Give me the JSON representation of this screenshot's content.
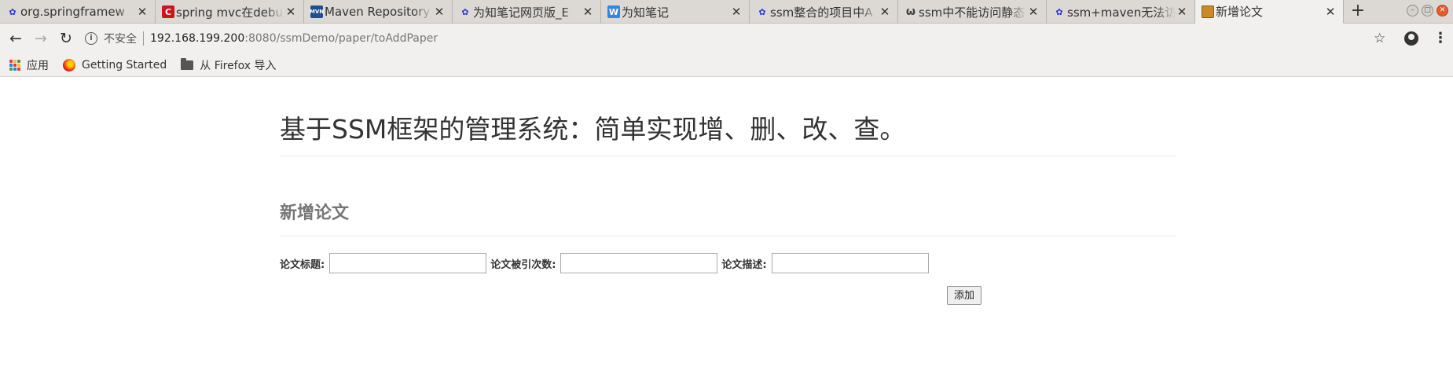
{
  "browser": {
    "tabs": [
      {
        "title": "org.springframew",
        "favicon": "baidu-paw-icon",
        "favicon_color": "#2932e1",
        "active": false
      },
      {
        "title": "spring mvc在debu",
        "favicon": "csdn-icon",
        "favicon_color": "#c9161d",
        "active": false
      },
      {
        "title": "Maven Repository",
        "favicon": "mvn-icon",
        "favicon_color": "#1f4f8f",
        "active": false
      },
      {
        "title": "为知笔记网页版_E",
        "favicon": "baidu-paw-icon",
        "favicon_color": "#2932e1",
        "active": false
      },
      {
        "title": "为知笔记",
        "favicon": "wiz-icon",
        "favicon_color": "#2f87e6",
        "active": false
      },
      {
        "title": "ssm整合的项目中A",
        "favicon": "baidu-paw-icon",
        "favicon_color": "#2932e1",
        "active": false
      },
      {
        "title": "ssm中不能访问静态",
        "favicon": "omega-icon",
        "favicon_color": "#444444",
        "active": false
      },
      {
        "title": "ssm+maven无法访",
        "favicon": "baidu-paw-icon",
        "favicon_color": "#2932e1",
        "active": false
      },
      {
        "title": "新增论文",
        "favicon": "page-icon",
        "favicon_color": "#c98b2a",
        "active": true
      }
    ],
    "new_tab": "+",
    "address": {
      "security_label": "不安全",
      "url_host": "192.168.199.200",
      "url_rest": ":8080/ssmDemo/paper/toAddPaper"
    },
    "bookmarks": [
      {
        "label": "应用",
        "icon": "apps-grid-icon"
      },
      {
        "label": "Getting Started",
        "icon": "firefox-icon"
      },
      {
        "label": "从 Firefox 导入",
        "icon": "folder-icon"
      }
    ]
  },
  "page": {
    "title": "基于SSM框架的管理系统：简单实现增、删、改、查。",
    "subtitle": "新增论文",
    "form": {
      "fields": [
        {
          "label": "论文标题:",
          "value": ""
        },
        {
          "label": "论文被引次数:",
          "value": ""
        },
        {
          "label": "论文描述:",
          "value": ""
        }
      ],
      "submit_label": "添加"
    }
  },
  "colors": {
    "tabstrip_bg": "#dcd9d4",
    "toolbar_bg": "#f1f0ee",
    "close_button": "#e85c2c"
  }
}
